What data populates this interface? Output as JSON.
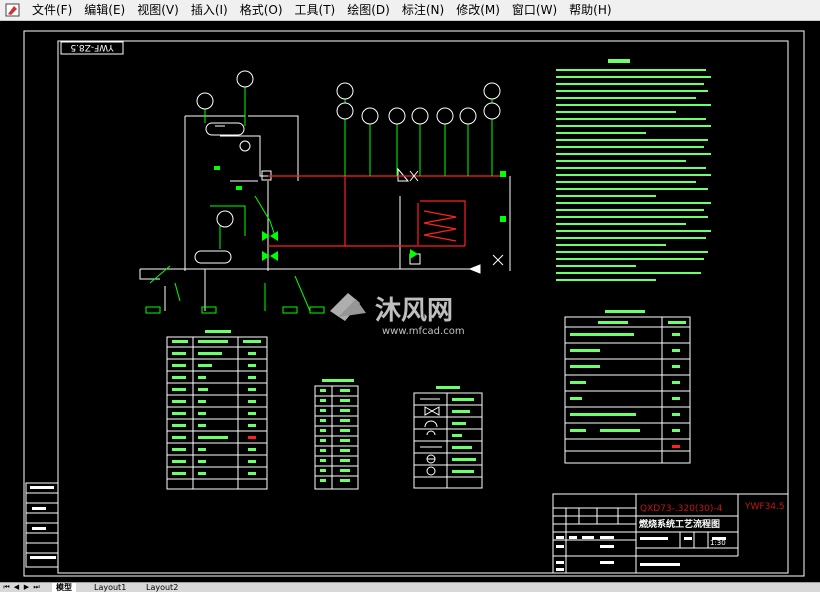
{
  "menu": {
    "items": [
      "文件(F)",
      "编辑(E)",
      "视图(V)",
      "插入(I)",
      "格式(O)",
      "工具(T)",
      "绘图(D)",
      "标注(N)",
      "修改(M)",
      "窗口(W)",
      "帮助(H)"
    ]
  },
  "drawing": {
    "rotated_label": "YWF-Z8.5",
    "title_block": {
      "code": "QXD73-.320(30)-4",
      "code_right": "YWF34.5",
      "drawing_title": "燃烧系统工艺流程图",
      "scale": "1:30"
    }
  },
  "watermark": {
    "brand_cn": "沐风网",
    "url": "www.mfcad.com"
  },
  "tabs": {
    "model": "模型",
    "layout1": "Layout1",
    "layout2": "Layout2"
  },
  "colors": {
    "line_white": "#ffffff",
    "line_green": "#00ff00",
    "line_red": "#ff2020",
    "text_green": "#6cff6c"
  }
}
